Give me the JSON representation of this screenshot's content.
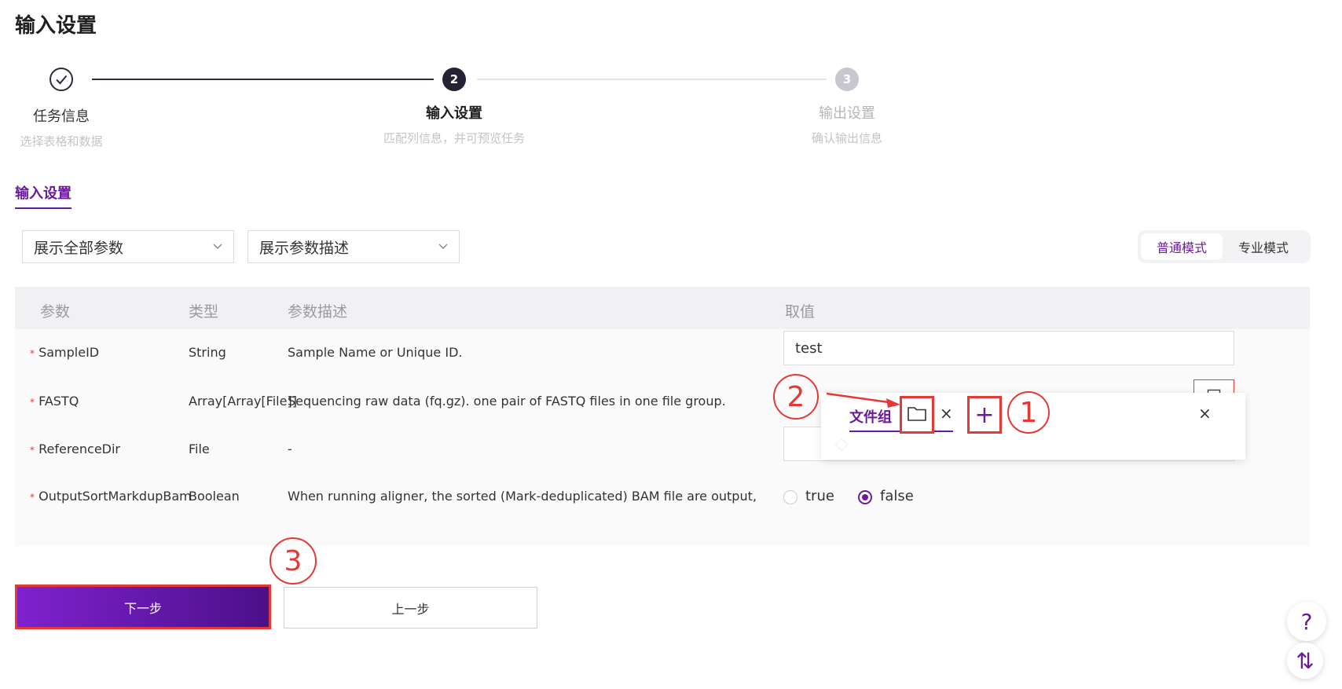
{
  "page": {
    "title": "输入设置"
  },
  "steps": [
    {
      "title": "任务信息",
      "desc": "选择表格和数据",
      "state": "done"
    },
    {
      "number": "2",
      "title": "输入设置",
      "desc": "匹配列信息，并可预览任务",
      "state": "active"
    },
    {
      "number": "3",
      "title": "输出设置",
      "desc": "确认输出信息",
      "state": "pending"
    }
  ],
  "section_tab": "输入设置",
  "filters": {
    "param_scope": "展示全部参数",
    "desc_mode": "展示参数描述"
  },
  "mode_toggle": {
    "normal": "普通模式",
    "pro": "专业模式",
    "active": "普通模式"
  },
  "table": {
    "headers": [
      "参数",
      "类型",
      "参数描述",
      "取值"
    ],
    "rows": [
      {
        "required": "*",
        "name": "SampleID",
        "type": "String",
        "desc": "Sample Name or Unique ID.",
        "value": "test"
      },
      {
        "required": "*",
        "name": "FASTQ",
        "type": "Array[Array[File]]",
        "desc": "Sequencing raw data (fq.gz). one pair of FASTQ files in one file group.",
        "value": ""
      },
      {
        "required": "*",
        "name": "ReferenceDir",
        "type": "File",
        "desc": "-",
        "value": ""
      },
      {
        "required": "*",
        "name": "OutputSortMarkdupBam",
        "type": "Boolean",
        "desc": "When running aligner, the sorted (Mark-deduplicated) BAM file are output, default is f...",
        "options": [
          "true",
          "false"
        ],
        "selected": "false"
      }
    ]
  },
  "popup": {
    "tab_label": "文件组",
    "close_glyph": "×",
    "add_glyph": "+"
  },
  "annotations": {
    "a1": "1",
    "a2": "2",
    "a3": "3"
  },
  "buttons": {
    "next": "下一步",
    "prev": "上一步"
  },
  "float": {
    "help": "?",
    "sort": "⇅"
  },
  "colors": {
    "accent": "#6a1b9a",
    "annotation": "#e53935"
  }
}
